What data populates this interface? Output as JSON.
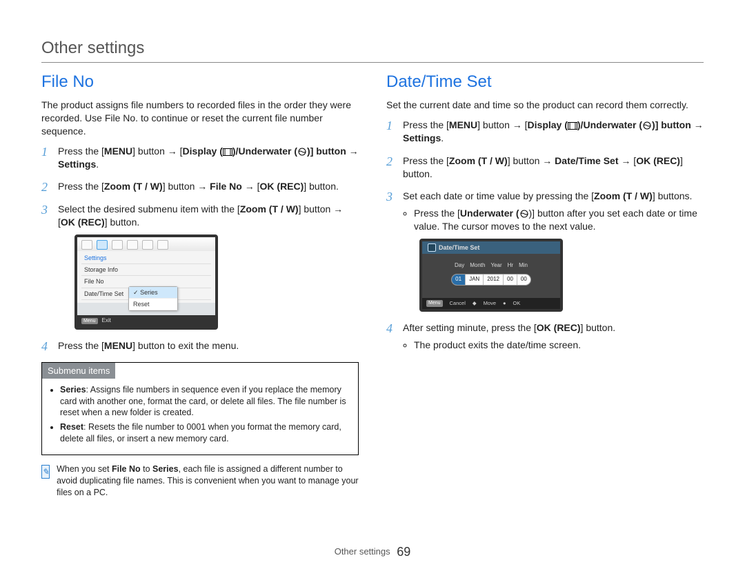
{
  "header": "Other settings",
  "footer": {
    "label": "Other settings",
    "page": "69"
  },
  "left": {
    "title": "File No",
    "intro": "The product assigns file numbers to recorded files in the order they were recorded. Use File No. to continue or reset the current file number sequence.",
    "steps": {
      "s1": {
        "t1": "Press the [",
        "menu": "MENU",
        "t2": "] button ",
        "t3": " [",
        "disp": "Display (",
        "t4": ")/",
        "uw": "Underwater (",
        "t5": ")] button ",
        "t6": " ",
        "settings": "Settings",
        "t7": "."
      },
      "s2": {
        "t1": "Press the [",
        "zoom": "Zoom (T / W)",
        "t2": "] button ",
        "t3": " ",
        "fileno": "File No",
        "t4": " ",
        "t5": " [",
        "okrec": "OK (REC)",
        "t6": "] button."
      },
      "s3": {
        "t1": "Select the desired submenu item with the [",
        "zoom": "Zoom (T / W)",
        "t2": "] button ",
        "t3": " [",
        "okrec": "OK (REC)",
        "t4": "] button."
      },
      "s4": {
        "t1": "Press the [",
        "menu": "MENU",
        "t2": "] button to exit the menu."
      }
    },
    "mock": {
      "heading": "Settings",
      "rows": [
        "Storage Info",
        "File No",
        "Date/Time Set"
      ],
      "popup": [
        "Series",
        "Reset"
      ],
      "foot_menu": "Menu",
      "foot_exit": "Exit"
    },
    "submenu": {
      "head": "Submenu items",
      "series_label": "Series",
      "series_text": ": Assigns file numbers in sequence even if you replace the memory card with another one, format the card, or delete all files. The file number is reset when a new folder is created.",
      "reset_label": "Reset",
      "reset_text": ": Resets the file number to 0001 when you format the memory card, delete all files, or insert a new memory card."
    },
    "note": {
      "t1": "When you set ",
      "b1": "File No",
      "t2": " to ",
      "b2": "Series",
      "t3": ", each file is assigned a different number to avoid duplicating file names. This is convenient when you want to manage your files on a PC."
    }
  },
  "right": {
    "title": "Date/Time Set",
    "intro": "Set the current date and time so the product can record them correctly.",
    "steps": {
      "s1": {
        "t1": "Press the [",
        "menu": "MENU",
        "t2": "] button ",
        "t3": " [",
        "disp": "Display (",
        "t4": ")/",
        "uw": "Underwater (",
        "t5": ")] button ",
        "t6": " ",
        "settings": "Settings",
        "t7": "."
      },
      "s2": {
        "t1": "Press the [",
        "zoom": "Zoom (T / W)",
        "t2": "] button ",
        "t3": " ",
        "dts": "Date/Time Set",
        "t4": " ",
        "t5": " [",
        "okrec": "OK (REC)",
        "t6": "] button."
      },
      "s3": {
        "t1": "Set each date or time value by pressing the [",
        "zoom": "Zoom (T / W)",
        "t2": "] buttons.",
        "sub_t1": "Press the [",
        "sub_uw": "Underwater (",
        "sub_t2": ")] button after you set each date or time value. The cursor moves to the next value."
      },
      "s4": {
        "t1": "After setting minute, press the [",
        "okrec": "OK (REC)",
        "t2": "] button.",
        "sub": "The product exits the date/time screen."
      }
    },
    "mock": {
      "title": "Date/Time Set",
      "labels": [
        "Day",
        "Month",
        "Year",
        "Hr",
        "Min"
      ],
      "values": [
        "01",
        "JAN",
        "2012",
        "00",
        "00"
      ],
      "foot_menu": "Menu",
      "foot_cancel": "Cancel",
      "foot_move": "Move",
      "foot_ok": "OK"
    }
  },
  "glyphs": {
    "arrow": "→",
    "check": "✓"
  }
}
